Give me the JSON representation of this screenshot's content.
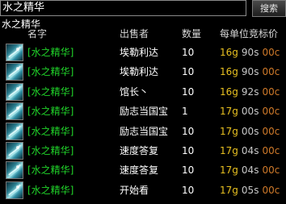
{
  "search": {
    "value": "水之精华",
    "button_label": "搜索",
    "hint": "水之精华"
  },
  "columns": {
    "name": "名字",
    "seller": "出售者",
    "quantity": "数量",
    "unit_price": "每单位竞标价"
  },
  "currency_units": {
    "gold": "g",
    "silver": "s",
    "copper": "c"
  },
  "rows": [
    {
      "name": "[水之精华]",
      "seller": "埃勒利达",
      "quantity": "10",
      "gold": "16",
      "silver": "90",
      "copper": "00"
    },
    {
      "name": "[水之精华]",
      "seller": "埃勒利达",
      "quantity": "10",
      "gold": "16",
      "silver": "90",
      "copper": "00"
    },
    {
      "name": "[水之精华]",
      "seller": "馆长丶",
      "quantity": "10",
      "gold": "16",
      "silver": "92",
      "copper": "00"
    },
    {
      "name": "[水之精华]",
      "seller": "励志当国宝",
      "quantity": "1",
      "gold": "17",
      "silver": "00",
      "copper": "00"
    },
    {
      "name": "[水之精华]",
      "seller": "励志当国宝",
      "quantity": "10",
      "gold": "17",
      "silver": "00",
      "copper": "00"
    },
    {
      "name": "[水之精华]",
      "seller": "速度答复",
      "quantity": "10",
      "gold": "17",
      "silver": "04",
      "copper": "00"
    },
    {
      "name": "[水之精华]",
      "seller": "速度答复",
      "quantity": "10",
      "gold": "17",
      "silver": "04",
      "copper": "00"
    },
    {
      "name": "[水之精华]",
      "seller": "开始看",
      "quantity": "10",
      "gold": "17",
      "silver": "05",
      "copper": "00"
    }
  ],
  "colors": {
    "item_name": "#21d42a",
    "gold": "#e8c020",
    "silver": "#c8c8c8",
    "copper": "#d07a2a"
  },
  "icons": {
    "item": "water-essence-icon"
  }
}
